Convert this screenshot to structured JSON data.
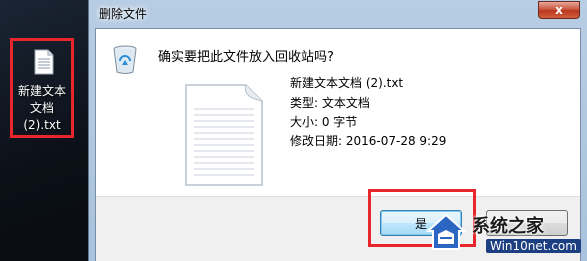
{
  "desktop": {
    "file_label": "新建文本文档 (2).txt",
    "icon": "text-file-icon"
  },
  "dialog": {
    "title": "删除文件",
    "close_symbol": "x",
    "question": "确实要把此文件放入回收站吗?",
    "file_name": "新建文本文档 (2).txt",
    "file_type": "类型: 文本文档",
    "file_size": "大小: 0 字节",
    "file_modified": "修改日期: 2016-07-28 9:29",
    "yes_label": "是",
    "no_label": "",
    "recycle_icon": "recycle-bin-icon",
    "preview_icon": "text-document-icon"
  },
  "watermark": {
    "title": "系统之家",
    "url": "Win10net.com"
  },
  "colors": {
    "highlight": "#e8262b",
    "title_bar": "#b7cde3",
    "close_button": "#c95841"
  }
}
